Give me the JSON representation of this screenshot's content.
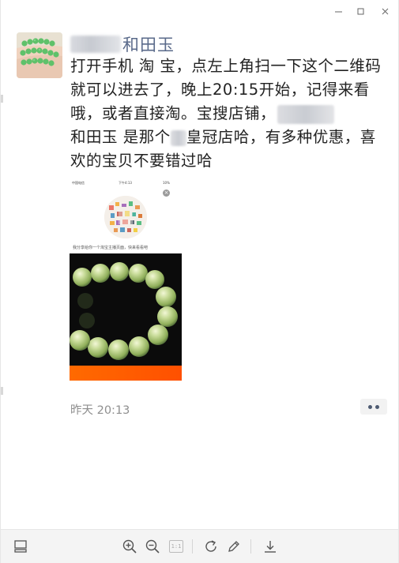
{
  "window": {
    "minimize_glyph": "—",
    "maximize_glyph": "□",
    "close_glyph": "✕"
  },
  "post": {
    "username_suffix": "和田玉",
    "text_part1": "打开手机 淘  宝，点左上角扫一下这个二维码就可以进去了，晚上20:15开始，记得来看哦，或者直接淘。宝搜店铺，",
    "text_part2": "和田玉  是那个",
    "text_part3": "皇冠店哈，有多种优惠，喜欢的宝贝不要错过哈",
    "time": "昨天 20:13"
  },
  "share_card": {
    "status_carrier": "中国电信 ",
    "status_time": "下午4:13",
    "status_battery": "10% ",
    "close_glyph": "×",
    "caption": "我分享给你一个淘宝主播页面，快来看看吧"
  },
  "toolbar": {
    "icons": [
      "layout-icon",
      "zoom-in-icon",
      "zoom-out-icon",
      "actual-size-icon",
      "rotate-icon",
      "edit-icon",
      "download-icon"
    ],
    "actual_size_label": "1:1"
  },
  "colors": {
    "username": "#5a6a8a",
    "text": "#222222",
    "time": "#8f8f8f",
    "accent_orange": "#ff5000",
    "jade": "#b9d48f"
  }
}
